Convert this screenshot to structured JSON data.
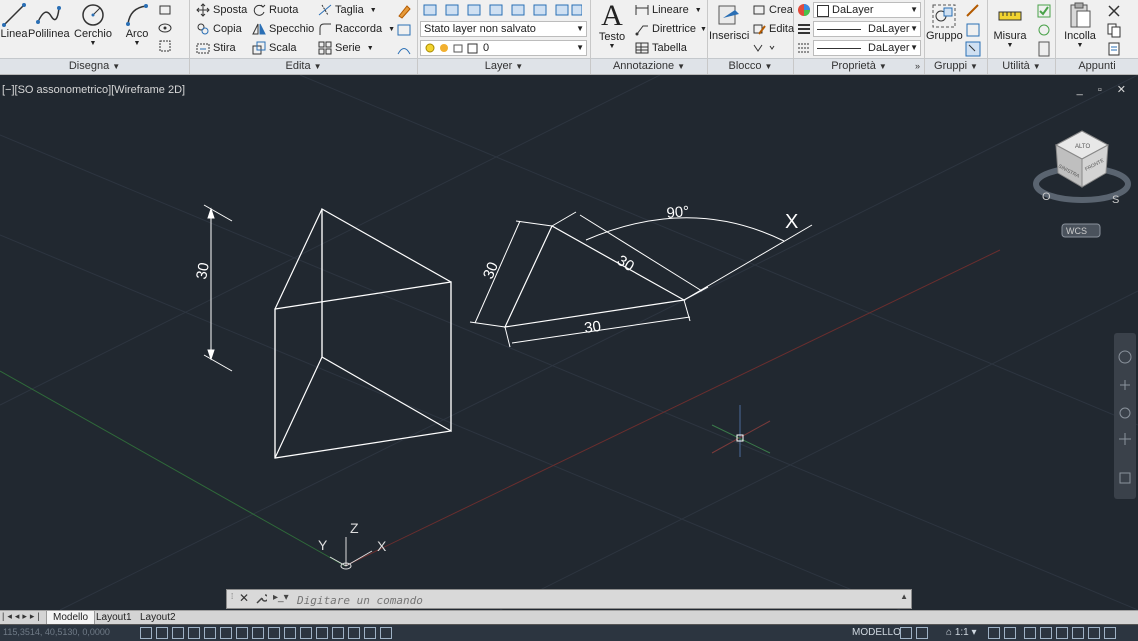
{
  "ribbon": {
    "disegna": {
      "title": "Disegna",
      "linea": "Linea",
      "polilinea": "Polilinea",
      "cerchio": "Cerchio",
      "arco": "Arco"
    },
    "edita": {
      "title": "Edita",
      "sposta": "Sposta",
      "ruota": "Ruota",
      "taglia": "Taglia",
      "copia": "Copia",
      "specchio": "Specchio",
      "raccorda": "Raccorda",
      "stira": "Stira",
      "scala": "Scala",
      "serie": "Serie"
    },
    "layer": {
      "title": "Layer",
      "stato": "Stato layer non salvato",
      "current": "0"
    },
    "annotazione": {
      "title": "Annotazione",
      "testo": "Testo",
      "lineare": "Lineare",
      "direttrice": "Direttrice",
      "tabella": "Tabella"
    },
    "blocco": {
      "title": "Blocco",
      "inserisci": "Inserisci",
      "crea": "Crea",
      "edita": "Edita"
    },
    "proprieta": {
      "title": "Proprietà",
      "color": "DaLayer",
      "linetype": "DaLayer",
      "lineweight": "DaLayer"
    },
    "gruppi": {
      "title": "Gruppi",
      "gruppo": "Gruppo"
    },
    "utilita": {
      "title": "Utilità",
      "misura": "Misura"
    },
    "appunti": {
      "title": "Appunti",
      "incolla": "Incolla"
    }
  },
  "viewport": {
    "label": "[−][SO assonometrico][Wireframe 2D]",
    "window_controls": "_ ▫ ✕",
    "viewcube": {
      "top": "ALTO",
      "left": "SINISTRA",
      "right": "FRONTE",
      "west": "O",
      "south": "S",
      "ucs": "WCS"
    },
    "ucs_icon": {
      "x": "X",
      "y": "Y",
      "z": "Z"
    },
    "dimensions": {
      "height": "30",
      "side_a": "30",
      "side_b": "30",
      "side_c": "30",
      "angle": "90°",
      "axis": "X"
    }
  },
  "command": {
    "placeholder": "Digitare un comando"
  },
  "layout_tabs": [
    "Modello",
    "Layout1",
    "Layout2"
  ],
  "status": {
    "coords": "115,3514, 40,5130, 0,0000",
    "mode": "MODELLO",
    "scale": "1:1"
  },
  "colors": {
    "background": "#212830",
    "ribbon": "#f0f0f0",
    "geometry": "#ffffff"
  }
}
